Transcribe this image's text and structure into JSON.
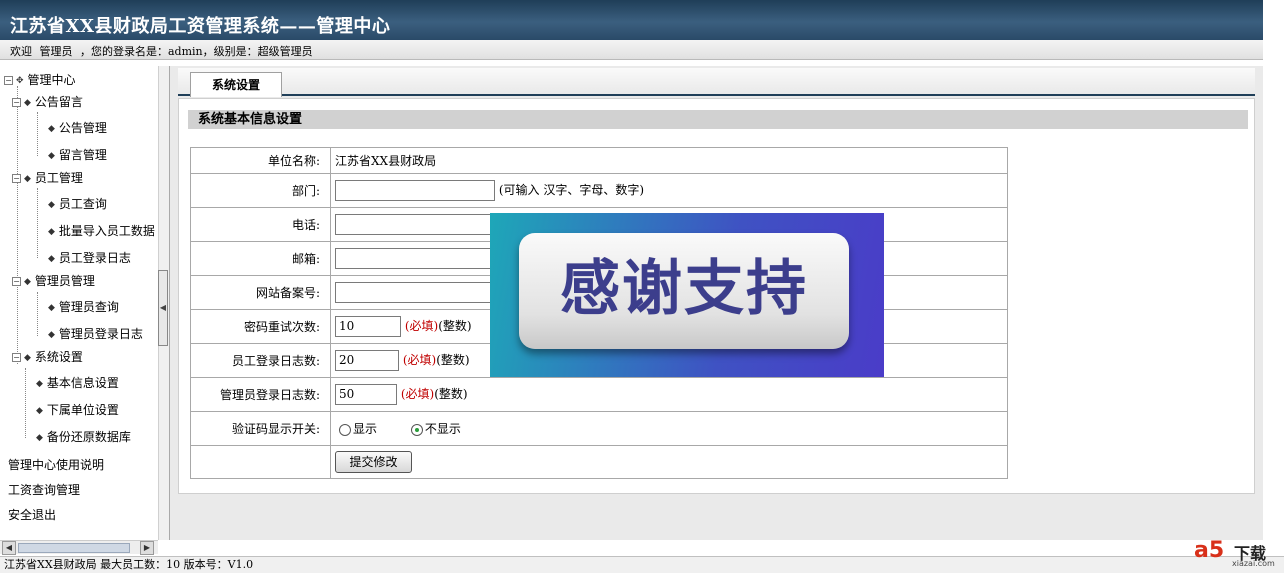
{
  "header": {
    "title": "江苏省XX县财政局工资管理系统——管理中心"
  },
  "welcome": {
    "greeting": "欢迎",
    "user": "管理员",
    "login_label": "，您的登录名是：admin，级别是：超级管理员"
  },
  "sidebar": {
    "root": "管理中心",
    "groups": [
      {
        "label": "公告留言",
        "items": [
          "公告管理",
          "留言管理"
        ]
      },
      {
        "label": "员工管理",
        "items": [
          "员工查询",
          "批量导入员工数据",
          "员工登录日志"
        ]
      },
      {
        "label": "管理员管理",
        "items": [
          "管理员查询",
          "管理员登录日志"
        ]
      },
      {
        "label": "系统设置",
        "items": [
          "基本信息设置",
          "下属单位设置",
          "备份还原数据库"
        ]
      }
    ],
    "links": [
      "管理中心使用说明",
      "工资查询管理",
      "安全退出"
    ]
  },
  "tabs": [
    {
      "label": "系统设置"
    }
  ],
  "section": {
    "title": "系统基本信息设置"
  },
  "form": {
    "unit_name_label": "单位名称:",
    "unit_name_value": "江苏省XX县财政局",
    "department_label": "部门:",
    "department_value": "",
    "department_hint": "(可输入 汉字、字母、数字)",
    "phone_label": "电话:",
    "phone_value": "",
    "email_label": "邮箱:",
    "email_value": "",
    "icp_label": "网站备案号:",
    "icp_value": "",
    "pwd_retry_label": "密码重试次数:",
    "pwd_retry_value": "10",
    "emp_log_label": "员工登录日志数:",
    "emp_log_value": "20",
    "admin_log_label": "管理员登录日志数:",
    "admin_log_value": "50",
    "required_text": "(必填)",
    "integer_text": "(整数)",
    "captcha_label": "验证码显示开关:",
    "captcha_options": [
      "显示",
      "不显示"
    ],
    "captcha_selected": "不显示",
    "submit_label": "提交修改"
  },
  "banner": {
    "text": "感谢支持"
  },
  "footer": {
    "text": "江苏省XX县财政局 最大员工数：10 版本号：V1.0"
  },
  "watermark": {
    "logo": "a5",
    "label": "下载",
    "url": "xiazai.com"
  }
}
